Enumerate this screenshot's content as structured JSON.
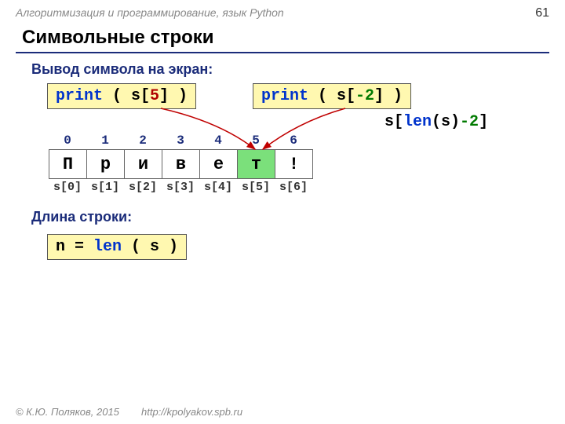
{
  "header": {
    "breadcrumb": "Алгоритмизация и программирование, язык Python",
    "page_number": "61"
  },
  "title": "Символьные строки",
  "subtitle1": "Вывод символа на экран:",
  "code1": {
    "kw": "print",
    "mid1": " ( s[",
    "num": "5",
    "mid2": "] )"
  },
  "code2": {
    "kw": "print",
    "mid1": " ( s[",
    "num": "-2",
    "mid2": "] )"
  },
  "expr": {
    "pre": "s[",
    "kw": "len",
    "mid": "(s)",
    "neg": "-2",
    "post": "]"
  },
  "top_indices": [
    "0",
    "1",
    "2",
    "3",
    "4",
    "5",
    "6"
  ],
  "chars": [
    "П",
    "р",
    "и",
    "в",
    "е",
    "т",
    "!"
  ],
  "highlight_index": 5,
  "bottom_indices": [
    "s[0]",
    "s[1]",
    "s[2]",
    "s[3]",
    "s[4]",
    "s[5]",
    "s[6]"
  ],
  "subtitle2": "Длина строки:",
  "code3": {
    "lhs": "n = ",
    "kw": "len",
    "rhs": " ( s )"
  },
  "footer": {
    "copyright": "© К.Ю. Поляков, 2015",
    "url": "http://kpolyakov.spb.ru"
  }
}
